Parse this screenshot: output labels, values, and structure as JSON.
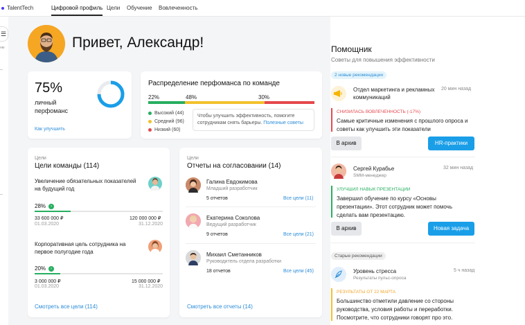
{
  "app": {
    "brand": "TalentTech"
  },
  "nav": [
    "Цифровой профиль",
    "Цели",
    "Обучение",
    "Вовлеченность"
  ],
  "sidebar": {
    "menu_icon": "hamburger-icon",
    "hint": "ню"
  },
  "greeting": "Привет, Александр!",
  "performance": {
    "value": "75%",
    "label": "личный перфоманс",
    "fraction": 0.75,
    "link": "Как улучшить",
    "color": "#1a9ee8"
  },
  "distribution": {
    "title": "Распределение перфоманса по команде",
    "segments": [
      {
        "pct": "22%",
        "share": 0.22,
        "color": "#27ae60"
      },
      {
        "pct": "48%",
        "share": 0.48,
        "color": "#f2c12e"
      },
      {
        "pct": "30%",
        "share": 0.3,
        "color": "#e5484d"
      }
    ],
    "legend": [
      {
        "label": "Высокий (44)",
        "color": "#27ae60"
      },
      {
        "label": "Средний (96)",
        "color": "#f2c12e"
      },
      {
        "label": "Низкий (60)",
        "color": "#e5484d"
      }
    ],
    "tip": "Чтобы улучшить эффективность, помогите сотрудникам снять барьеры.",
    "tip_link": "Полезные советы"
  },
  "goals": {
    "caption": "Цели",
    "title": "Цели команды (114)",
    "items": [
      {
        "title": "Увеличение обязательных показателей на будущий год",
        "pct": "28%",
        "fraction": 0.28,
        "from_amount": "33 600 000 ₽",
        "to_amount": "120 000 000 ₽",
        "from_date": "01.03.2020",
        "to_date": "31.12.2020"
      },
      {
        "title": "Корпоративная цель сотрудника на первое полугодие года",
        "pct": "20%",
        "fraction": 0.2,
        "from_amount": "3 000 000 ₽",
        "to_amount": "15 000 000 ₽",
        "from_date": "01.03.2020",
        "to_date": "31.12.2020"
      }
    ],
    "link": "Смотреть все цели (114)"
  },
  "reports": {
    "caption": "Цели",
    "title": "Отчеты на согласовании (14)",
    "items": [
      {
        "name": "Галина Евдокимова",
        "role": "Младший разработчик",
        "count": "5 отчетов",
        "link": "Все цели (11)"
      },
      {
        "name": "Екатерина Соколова",
        "role": "Ведущий разработчик",
        "count": "9 отчетов",
        "link": "Все цели (21)"
      },
      {
        "name": "Михаил Сметанников",
        "role": "Руководитель отдела разработки",
        "count": "18 отчетов",
        "link": "Все цели (45)"
      }
    ],
    "link": "Смотреть все отчеты (14)"
  },
  "assistant": {
    "title": "Помощник",
    "subtitle": "Советы для повышения эффективности",
    "new_badge": "2 новые рекомендации",
    "old_badge": "Старые рекомендации",
    "recs": [
      {
        "title": "Отдел маркетинга и рекламных коммуникаций",
        "time": "20 мин назад",
        "tag": "СНИЗИЛАСЬ ВОВЛЕЧЕННОСТЬ (-17%)",
        "tag_color": "#e5484d",
        "body": "Самые критичные изменения с прошлого опроса и советы как улучшить эти показатели",
        "btn1": "В архив",
        "btn2": "HR-практики"
      },
      {
        "title": "Сергей Курабье",
        "subtitle": "SMM-менеджер",
        "time": "32 мин назад",
        "tag": "УЛУЧШИЛ НАВЫК ПРЕЗЕНТАЦИИ",
        "tag_color": "#27ae60",
        "body": "Завершил обучение по курсу «Основы презентации». Этот сотрудник может помочь сделать вам презентацию.",
        "btn1": "В архив",
        "btn2": "Новая задача"
      },
      {
        "title": "Уровень стресса",
        "subtitle": "Результаты пульс-опроса",
        "time": "5 ч назад",
        "tag": "РЕЗУЛЬТАТЫ ОТ 22 МАРТА",
        "tag_color": "#f2a62e",
        "body": "Большинство отметили давление со стороны руководства, условия работы и переработки. Посмотрите, что сотрудники говорят про это."
      }
    ]
  }
}
